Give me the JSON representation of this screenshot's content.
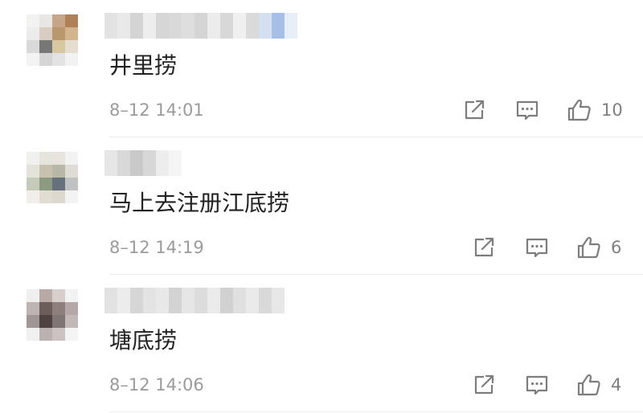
{
  "comments": [
    {
      "text": "井里捞",
      "time": "8–12 14:01",
      "likes": "10",
      "avatar_colors": [
        "#f2f2f0",
        "#e9e7e4",
        "#c6a588",
        "#b08058",
        "#ececec",
        "#d8cdc0",
        "#b9986e",
        "#d2b48f",
        "#d9d9d9",
        "#777777",
        "#d8c8a2",
        "#e4ddd0",
        "#f3f3f3",
        "#d5d5d5",
        "#e3e3e3",
        "#f2f2f2"
      ],
      "name_colors": [
        "#e3e3e3",
        "#e9e9e9",
        "#d4d4d4",
        "#ededed",
        "#d6d6d6",
        "#d9d9d9",
        "#dedede",
        "#d5d5d5",
        "#ececec",
        "#d8d8d8",
        "#f0f0f0",
        "#dadada",
        "#d4dff0",
        "#a7bfe6",
        "#e6eef8"
      ]
    },
    {
      "text": "马上去注册江底捞",
      "time": "8–12 14:19",
      "likes": "6",
      "avatar_colors": [
        "#f0f0ee",
        "#e6e5dc",
        "#e6e4dc",
        "#f2f2f2",
        "#e3e3dc",
        "#c7c2b0",
        "#b8b8a8",
        "#dedcd4",
        "#c6cab8",
        "#8b9a80",
        "#66717d",
        "#c1c1c1",
        "#f1efeb",
        "#e2ddd2",
        "#dcd8cd",
        "#f3f3f3"
      ],
      "name_colors": [
        "#e6e6e6",
        "#d8d8d8",
        "#c9c9c9",
        "#d7d7d7",
        "#ededed",
        "#f5f5f5"
      ]
    },
    {
      "text": "塘底捞",
      "time": "8–12 14:06",
      "likes": "4",
      "avatar_colors": [
        "#efefef",
        "#b9a9a4",
        "#d7cfcc",
        "#f2f2f2",
        "#bdb4b4",
        "#6c5c5a",
        "#8e7f7d",
        "#b4a9a8",
        "#a09695",
        "#4f4341",
        "#7f7574",
        "#c0b9b8",
        "#f1f0f0",
        "#bab2b2",
        "#cac3c2",
        "#f4f4f4"
      ],
      "name_colors": [
        "#e2e2e2",
        "#ececec",
        "#d6d6d6",
        "#e3e3e3",
        "#e8e8e8",
        "#d3d3d3",
        "#e6e6e6",
        "#dcdcdc",
        "#ebebeb",
        "#d1d1d1",
        "#e0e0e0",
        "#eaeaea",
        "#d9d9d9",
        "#e7e7e7"
      ]
    }
  ],
  "icons": {
    "share": "share-icon",
    "reply": "reply-icon",
    "like": "like-icon",
    "color": "#7d7d7d"
  }
}
